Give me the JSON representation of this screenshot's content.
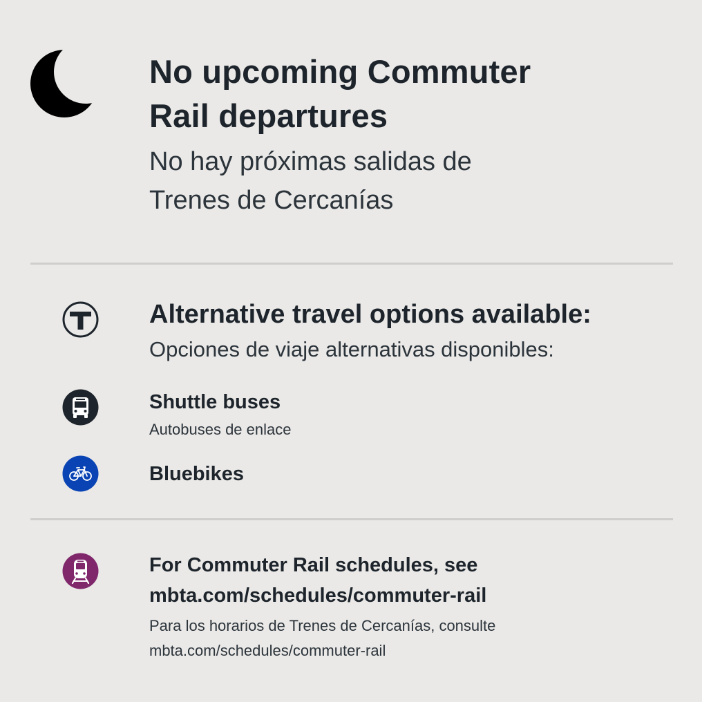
{
  "header": {
    "title_en_line1": "No upcoming Commuter",
    "title_en_line2": "Rail departures",
    "title_es_line1": "No hay próximas salidas de",
    "title_es_line2": "Trenes de Cercanías",
    "icon": "moon-icon"
  },
  "alternatives": {
    "icon": "mbta-t-icon",
    "heading_en": "Alternative travel options available:",
    "heading_es": "Opciones de viaje alternativas disponibles:",
    "options": [
      {
        "icon": "bus-icon",
        "label_en": "Shuttle buses",
        "label_es": "Autobuses de enlace",
        "color": "#1d242b"
      },
      {
        "icon": "bike-icon",
        "label_en": "Bluebikes",
        "color": "#0a44b4"
      }
    ]
  },
  "schedule": {
    "icon": "commuter-rail-icon",
    "color": "#80276c",
    "text_en_line1": "For Commuter Rail schedules, see",
    "text_en_line2": "mbta.com/schedules/commuter-rail",
    "text_es_line1": "Para los horarios de Trenes de Cercanías, consulte",
    "text_es_line2": "mbta.com/schedules/commuter-rail"
  },
  "colors": {
    "background": "#eae9e7",
    "text": "#1d242b",
    "divider": "#cfcecc"
  }
}
